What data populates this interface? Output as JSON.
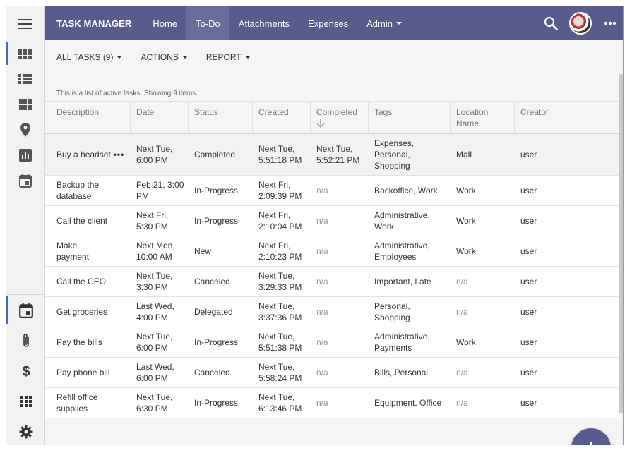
{
  "app": {
    "brand": "TASK MANAGER"
  },
  "nav": [
    {
      "label": "Home",
      "active": false
    },
    {
      "label": "To-Do",
      "active": true
    },
    {
      "label": "Attachments",
      "active": false
    },
    {
      "label": "Expenses",
      "active": false
    },
    {
      "label": "Admin",
      "active": false,
      "dropdown": true
    }
  ],
  "sidebar": {
    "top": [
      "menu-icon"
    ],
    "items": [
      "grid-view-icon",
      "list-view-icon",
      "cards-view-icon",
      "map-view-icon",
      "chart-view-icon",
      "calendar-view-icon"
    ],
    "lower": [
      "calendar-icon",
      "attachment-icon",
      "dollar-icon",
      "apps-icon",
      "settings-icon"
    ]
  },
  "toolbar": {
    "all_tasks": "ALL TASKS (9)",
    "actions": "ACTIONS",
    "report": "REPORT"
  },
  "info_text": "This is a list of active tasks. Showing 9 items.",
  "columns": {
    "description": "Description",
    "date": "Date",
    "status": "Status",
    "created": "Created",
    "completed": "Completed",
    "tags": "Tags",
    "location_l1": "Location",
    "location_l2": "Name",
    "creator": "Creator"
  },
  "rows": [
    {
      "description": "Buy a headset",
      "date": [
        "Next Tue,",
        "6:00 PM"
      ],
      "status": "Completed",
      "created": [
        "Next Tue,",
        "5:51:18 PM"
      ],
      "completed": [
        "Next Tue,",
        "5:52:21 PM"
      ],
      "tags": [
        "Expenses,",
        "Personal,",
        "Shopping"
      ],
      "location": "Mall",
      "creator": "user"
    },
    {
      "description": [
        "Backup the",
        "database"
      ],
      "date": [
        "Feb 21, 3:00",
        "PM"
      ],
      "status": "In-Progress",
      "created": [
        "Next Fri,",
        "2:09:39 PM"
      ],
      "completed": "n/a",
      "tags": [
        "Backoffice, Work"
      ],
      "location": "Work",
      "creator": "user"
    },
    {
      "description": [
        "Call the client"
      ],
      "date": [
        "Next Fri,",
        "5:30 PM"
      ],
      "status": "In-Progress",
      "created": [
        "Next Fri,",
        "2:10:04 PM"
      ],
      "completed": "n/a",
      "tags": [
        "Administrative,",
        "Work"
      ],
      "location": "Work",
      "creator": "user"
    },
    {
      "description": [
        "Make",
        "payment"
      ],
      "date": [
        "Next Mon,",
        "10:00 AM"
      ],
      "status": "New",
      "created": [
        "Next Fri,",
        "2:10:23 PM"
      ],
      "completed": "n/a",
      "tags": [
        "Administrative,",
        "Employees"
      ],
      "location": "Work",
      "creator": "user"
    },
    {
      "description": [
        "Call the CEO"
      ],
      "date": [
        "Next Tue,",
        "3:30 PM"
      ],
      "status": "Canceled",
      "created": [
        "Next Tue,",
        "3:29:33 PM"
      ],
      "completed": "n/a",
      "tags": [
        "Important, Late"
      ],
      "location": "n/a",
      "creator": "user"
    },
    {
      "description": [
        "Get groceries"
      ],
      "date": [
        "Last Wed,",
        "4:00 PM"
      ],
      "status": "Delegated",
      "created": [
        "Next Tue,",
        "3:37:36 PM"
      ],
      "completed": "n/a",
      "tags": [
        "Personal,",
        "Shopping"
      ],
      "location": "n/a",
      "creator": "user"
    },
    {
      "description": [
        "Pay the bills"
      ],
      "date": [
        "Next Tue,",
        "6:00 PM"
      ],
      "status": "In-Progress",
      "created": [
        "Next Tue,",
        "5:51:38 PM"
      ],
      "completed": "n/a",
      "tags": [
        "Administrative,",
        "Payments"
      ],
      "location": "Work",
      "creator": "user"
    },
    {
      "description": [
        "Pay phone bill"
      ],
      "date": [
        "Last Wed,",
        "6:00 PM"
      ],
      "status": "Canceled",
      "created": [
        "Next Tue,",
        "5:58:24 PM"
      ],
      "completed": "n/a",
      "tags": [
        "Bills, Personal"
      ],
      "location": "n/a",
      "creator": "user"
    },
    {
      "description": [
        "Refill office",
        "supplies"
      ],
      "date": [
        "Next Tue,",
        "6:30 PM"
      ],
      "status": "In-Progress",
      "created": [
        "Next Tue,",
        "6:13:46 PM"
      ],
      "completed": "n/a",
      "tags": [
        "Equipment, Office"
      ],
      "location": "n/a",
      "creator": "user"
    }
  ],
  "icons": {
    "search": "search-icon",
    "more": "more-icon",
    "add": "add-icon",
    "sort": "sort-down-icon"
  }
}
